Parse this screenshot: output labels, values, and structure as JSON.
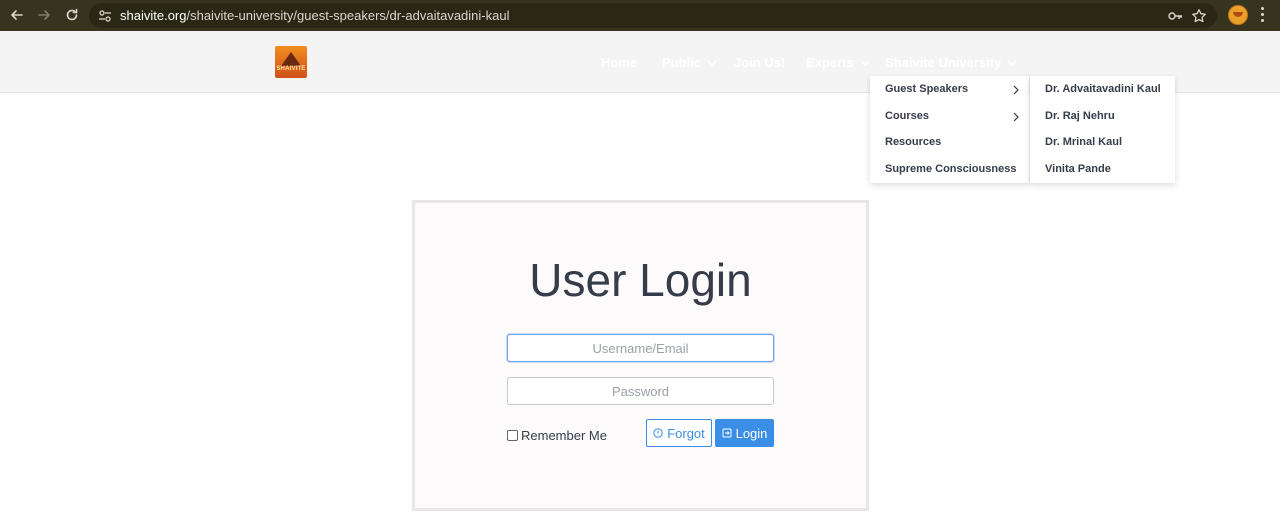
{
  "browser": {
    "url_host": "shaivite.org",
    "url_path": "/shaivite-university/guest-speakers/dr-advaitavadini-kaul"
  },
  "site": {
    "logo_text": "SHAIVITE",
    "nav": [
      {
        "label": "Home",
        "has_dropdown": false
      },
      {
        "label": "Public",
        "has_dropdown": true
      },
      {
        "label": "Join Us!",
        "has_dropdown": false
      },
      {
        "label": "Experts",
        "has_dropdown": true
      },
      {
        "label": "Shaivite University",
        "has_dropdown": true
      }
    ],
    "dropdown": {
      "items": [
        {
          "label": "Guest Speakers",
          "has_submenu": true
        },
        {
          "label": "Courses",
          "has_submenu": true
        },
        {
          "label": "Resources",
          "has_submenu": false
        },
        {
          "label": "Supreme Consciousness",
          "has_submenu": false
        }
      ],
      "submenu": [
        {
          "label": "Dr. Advaitavadini Kaul"
        },
        {
          "label": "Dr. Raj Nehru"
        },
        {
          "label": "Dr. Mrinal Kaul"
        },
        {
          "label": "Vinita Pande"
        }
      ]
    }
  },
  "login": {
    "title": "User Login",
    "username_placeholder": "Username/Email",
    "password_placeholder": "Password",
    "remember_label": "Remember Me",
    "forgot_label": "Forgot",
    "login_label": "Login"
  },
  "colors": {
    "accent": "#3a8ee6",
    "text": "#363c4a",
    "browser_bar": "#36331f"
  }
}
